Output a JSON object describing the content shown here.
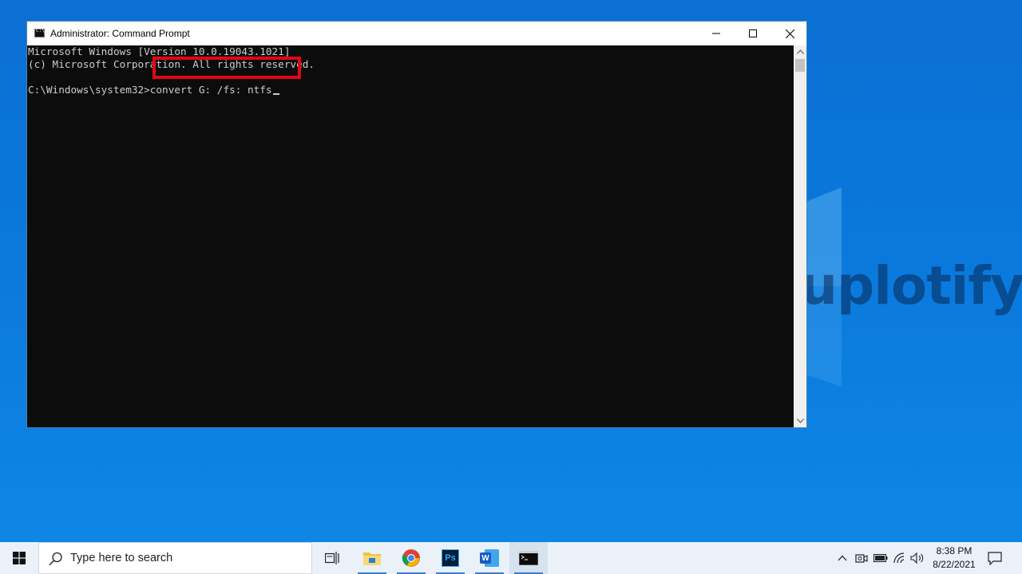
{
  "desktop": {
    "watermark_text": "uplotify",
    "background_color": "#0a78dc"
  },
  "window": {
    "title": "Administrator: Command Prompt",
    "icon": "cmd-icon",
    "controls": {
      "minimize_icon": "minimize-icon",
      "maximize_icon": "maximize-icon",
      "close_icon": "close-icon"
    }
  },
  "console": {
    "lines": [
      "Microsoft Windows [Version 10.0.19043.1021]",
      "(c) Microsoft Corporation. All rights reserved.",
      ""
    ],
    "prompt": "C:\\Windows\\system32>",
    "command": "convert G: /fs: ntfs",
    "highlight_color": "#e30613"
  },
  "taskbar": {
    "start_icon": "windows-start-icon",
    "search_placeholder": "Type here to search",
    "pinned": [
      {
        "name": "task-view-icon"
      },
      {
        "name": "file-explorer-icon"
      },
      {
        "name": "chrome-icon"
      },
      {
        "name": "photoshop-icon"
      },
      {
        "name": "word-icon"
      },
      {
        "name": "command-prompt-icon"
      }
    ],
    "photoshop_label": "Ps",
    "word_label": "W",
    "tray": {
      "icons": [
        "chevron-up-icon",
        "meet-now-icon",
        "battery-icon",
        "wifi-icon",
        "volume-icon"
      ]
    },
    "clock": {
      "time": "8:38 PM",
      "date": "8/22/2021"
    },
    "notification_icon": "notification-icon"
  }
}
